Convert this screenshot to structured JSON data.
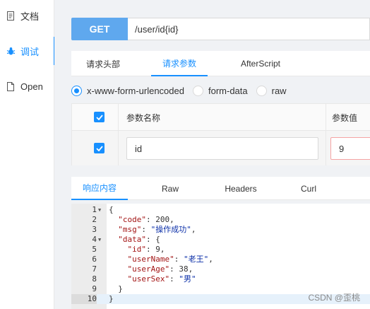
{
  "sidebar": {
    "items": [
      {
        "label": "文档",
        "icon": "document-icon"
      },
      {
        "label": "调试",
        "icon": "bug-icon",
        "active": true
      },
      {
        "label": "Open",
        "icon": "file-icon"
      }
    ]
  },
  "request": {
    "method": "GET",
    "url": "/user/id{id}"
  },
  "request_tabs": [
    "请求头部",
    "请求参数",
    "AfterScript"
  ],
  "content_types": [
    "x-www-form-urlencoded",
    "form-data",
    "raw"
  ],
  "params_table": {
    "headers": [
      "参数名称",
      "参数值"
    ],
    "rows": [
      {
        "name": "id",
        "value": "9"
      }
    ]
  },
  "response_tabs": [
    "响应内容",
    "Raw",
    "Headers",
    "Curl"
  ],
  "editor": {
    "lines": [
      {
        "num": "1",
        "fold": true,
        "parts": [
          {
            "t": "{",
            "c": "n"
          }
        ]
      },
      {
        "num": "2",
        "parts": [
          {
            "t": "  ",
            "c": "n"
          },
          {
            "t": "\"code\"",
            "c": "k"
          },
          {
            "t": ": 200,",
            "c": "n"
          }
        ]
      },
      {
        "num": "3",
        "parts": [
          {
            "t": "  ",
            "c": "n"
          },
          {
            "t": "\"msg\"",
            "c": "k"
          },
          {
            "t": ": ",
            "c": "n"
          },
          {
            "t": "\"操作成功\"",
            "c": "s"
          },
          {
            "t": ",",
            "c": "n"
          }
        ]
      },
      {
        "num": "4",
        "fold": true,
        "parts": [
          {
            "t": "  ",
            "c": "n"
          },
          {
            "t": "\"data\"",
            "c": "k"
          },
          {
            "t": ": {",
            "c": "n"
          }
        ]
      },
      {
        "num": "5",
        "parts": [
          {
            "t": "    ",
            "c": "n"
          },
          {
            "t": "\"id\"",
            "c": "k"
          },
          {
            "t": ": 9,",
            "c": "n"
          }
        ]
      },
      {
        "num": "6",
        "parts": [
          {
            "t": "    ",
            "c": "n"
          },
          {
            "t": "\"userName\"",
            "c": "k"
          },
          {
            "t": ": ",
            "c": "n"
          },
          {
            "t": "\"老王\"",
            "c": "s"
          },
          {
            "t": ",",
            "c": "n"
          }
        ]
      },
      {
        "num": "7",
        "parts": [
          {
            "t": "    ",
            "c": "n"
          },
          {
            "t": "\"userAge\"",
            "c": "k"
          },
          {
            "t": ": 38,",
            "c": "n"
          }
        ]
      },
      {
        "num": "8",
        "parts": [
          {
            "t": "    ",
            "c": "n"
          },
          {
            "t": "\"userSex\"",
            "c": "k"
          },
          {
            "t": ": ",
            "c": "n"
          },
          {
            "t": "\"男\"",
            "c": "s"
          }
        ]
      },
      {
        "num": "9",
        "parts": [
          {
            "t": "  }",
            "c": "n"
          }
        ]
      },
      {
        "num": "10",
        "active": true,
        "parts": [
          {
            "t": "}",
            "c": "n"
          }
        ]
      }
    ]
  },
  "watermark": "CSDN @歪桃",
  "colors": {
    "accent": "#1890ff",
    "method_bg": "#5fa8ee",
    "json_key": "#a31515",
    "json_string": "#0b2fa8"
  }
}
